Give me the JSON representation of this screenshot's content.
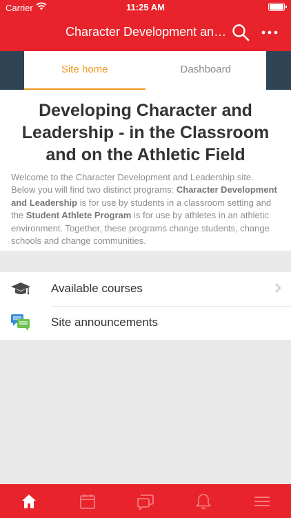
{
  "status_bar": {
    "carrier": "Carrier",
    "time": "11:25 AM"
  },
  "nav": {
    "title": "Character Development and Leadership"
  },
  "tabs": [
    {
      "label": "Site home",
      "active": true
    },
    {
      "label": "Dashboard",
      "active": false
    }
  ],
  "content": {
    "title": "Developing Character and Leadership - in the Classroom and on the Athletic Field",
    "summary_parts": {
      "p1": "Welcome to the Character Development and Leadership site. Below you will find two distinct programs: ",
      "b1": "Character Development and Leadership",
      "p2": " is for use by students in a classroom setting and the ",
      "b2": "Student Athlete Program",
      "p3": " is for use by athletes in an athletic environment. Together, these programs change students, change schools and change communities."
    }
  },
  "list": [
    {
      "label": "Available courses",
      "icon": "graduation-cap-icon"
    },
    {
      "label": "Site announcements",
      "icon": "chat-bubbles-icon"
    }
  ],
  "bottom_tabs": [
    {
      "icon": "home-icon",
      "active": true
    },
    {
      "icon": "calendar-icon",
      "active": false
    },
    {
      "icon": "messages-icon",
      "active": false
    },
    {
      "icon": "bell-icon",
      "active": false
    },
    {
      "icon": "menu-icon",
      "active": false
    }
  ],
  "colors": {
    "brand_red": "#e8232b",
    "accent_orange": "#f0981e",
    "dark_slate": "#2f4454"
  }
}
